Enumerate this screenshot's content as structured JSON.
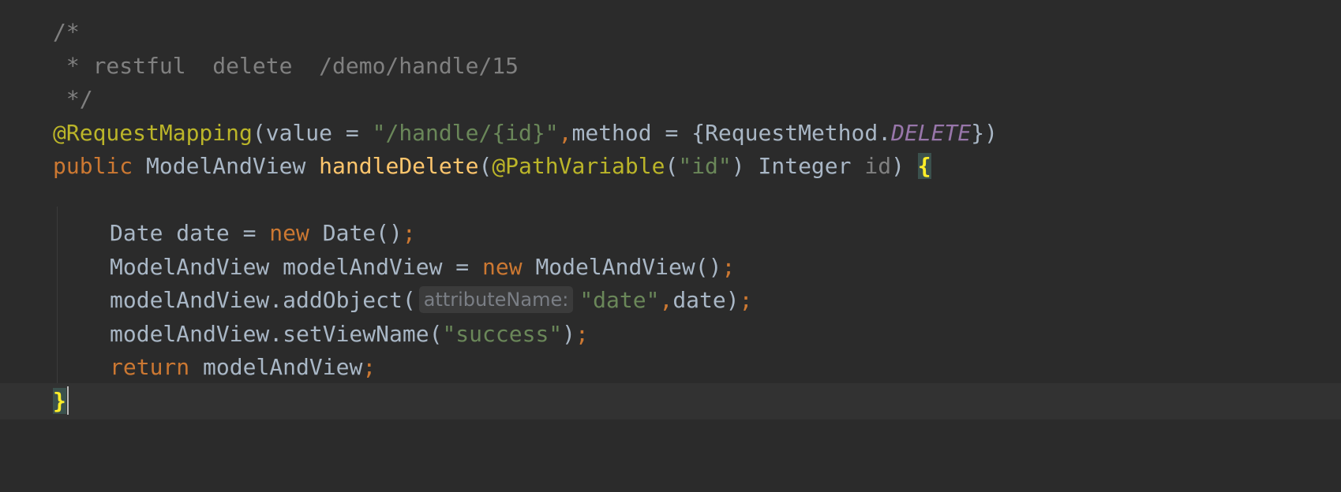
{
  "editor": {
    "comment_open": "/*",
    "comment_body": " * restful  delete  /demo/handle/15",
    "comment_close": " */",
    "annotation": {
      "name": "@RequestMapping",
      "open_paren": "(",
      "attr_value": "value",
      "eq1": " = ",
      "path": "\"/handle/{id}\"",
      "comma": ",",
      "attr_method": "method",
      "eq2": " = ",
      "brace_open": "{",
      "enum_class": "RequestMethod.",
      "enum_value": "DELETE",
      "brace_close": "})"
    },
    "signature": {
      "modifier": "public",
      "return_type": " ModelAndView ",
      "method_name": "handleDelete",
      "open_paren": "(",
      "param_annotation": "@PathVariable",
      "ann_open": "(",
      "ann_value": "\"id\"",
      "ann_close": ")",
      "param_type": " Integer ",
      "param_name": "id",
      "close_paren": ") ",
      "body_open": "{"
    },
    "stmt1": {
      "decl": "Date date = ",
      "kw_new": "new",
      "ctor": " Date()",
      "semi": ";"
    },
    "stmt2": {
      "decl": "ModelAndView modelAndView = ",
      "kw_new": "new",
      "ctor": " ModelAndView()",
      "semi": ";"
    },
    "stmt3": {
      "call": "modelAndView.addObject(",
      "hint": "attributeName:",
      "arg1": "\"date\"",
      "comma": ",",
      "arg2": "date)",
      "semi": ";"
    },
    "stmt4": {
      "call": "modelAndView.setViewName(",
      "arg": "\"success\"",
      "close": ")",
      "semi": ";"
    },
    "stmt5": {
      "kw_return": "return",
      "value": " modelAndView",
      "semi": ";"
    },
    "closing_brace": "}"
  },
  "colors": {
    "background": "#2b2b2b",
    "comment": "#808080",
    "annotation": "#bbb529",
    "keyword": "#cc7832",
    "string": "#6a8759",
    "method": "#ffc66d",
    "constant": "#9876aa",
    "text": "#a9b7c6"
  }
}
